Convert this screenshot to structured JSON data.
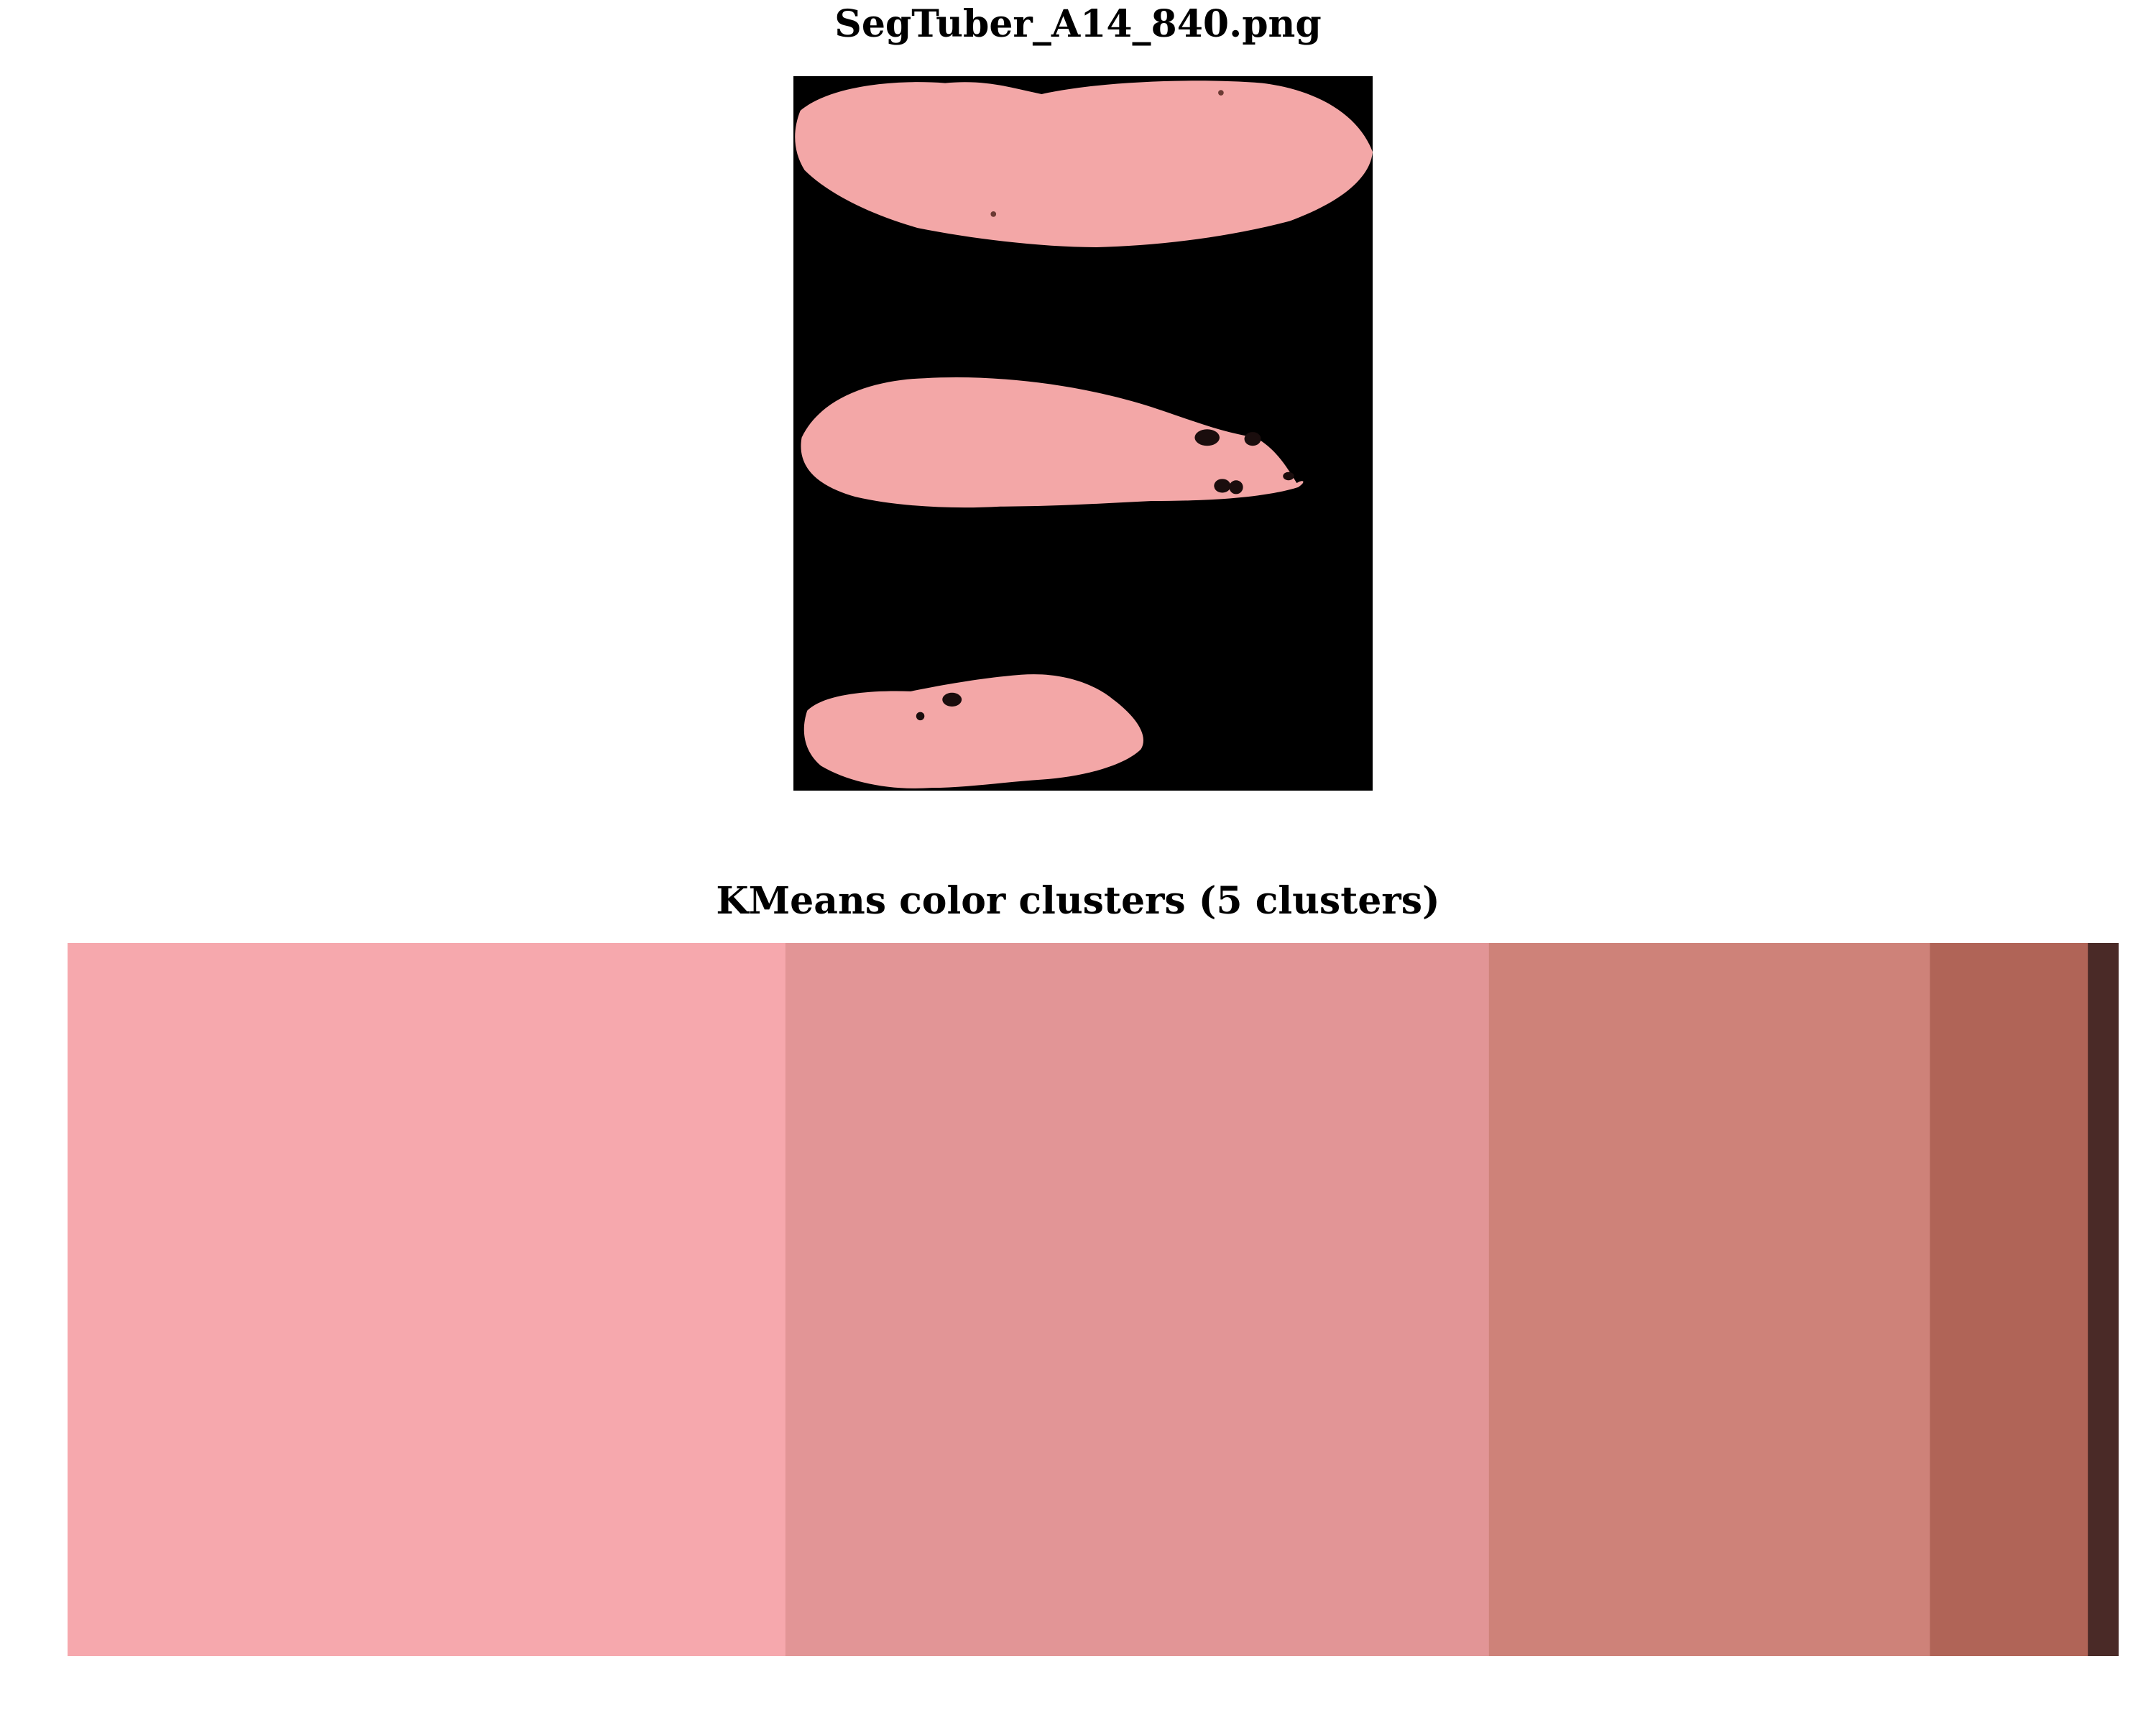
{
  "figure": {
    "image_title": "SegTuber_A14_840.png",
    "clusters_title": "KMeans color clusters (5 clusters)"
  },
  "image": {
    "background_color": "#000000",
    "flesh_color": "#f3a7a7",
    "spot_color": "#1a0d0d",
    "content": "three segmented pink tuber slices on black background"
  },
  "chart_data": {
    "type": "bar",
    "orientation": "horizontal-stacked",
    "title": "KMeans color clusters (5 clusters)",
    "xlabel": "",
    "ylabel": "",
    "xlim": [
      0,
      1
    ],
    "grid": false,
    "axes_visible": false,
    "legend": "none",
    "series": [
      {
        "color": "#f6a8ad",
        "value": 0.35
      },
      {
        "color": "#e29596",
        "value": 0.343
      },
      {
        "color": "#ce8279",
        "value": 0.215
      },
      {
        "color": "#b06457",
        "value": 0.077
      },
      {
        "color": "#4a2a27",
        "value": 0.015
      }
    ]
  }
}
